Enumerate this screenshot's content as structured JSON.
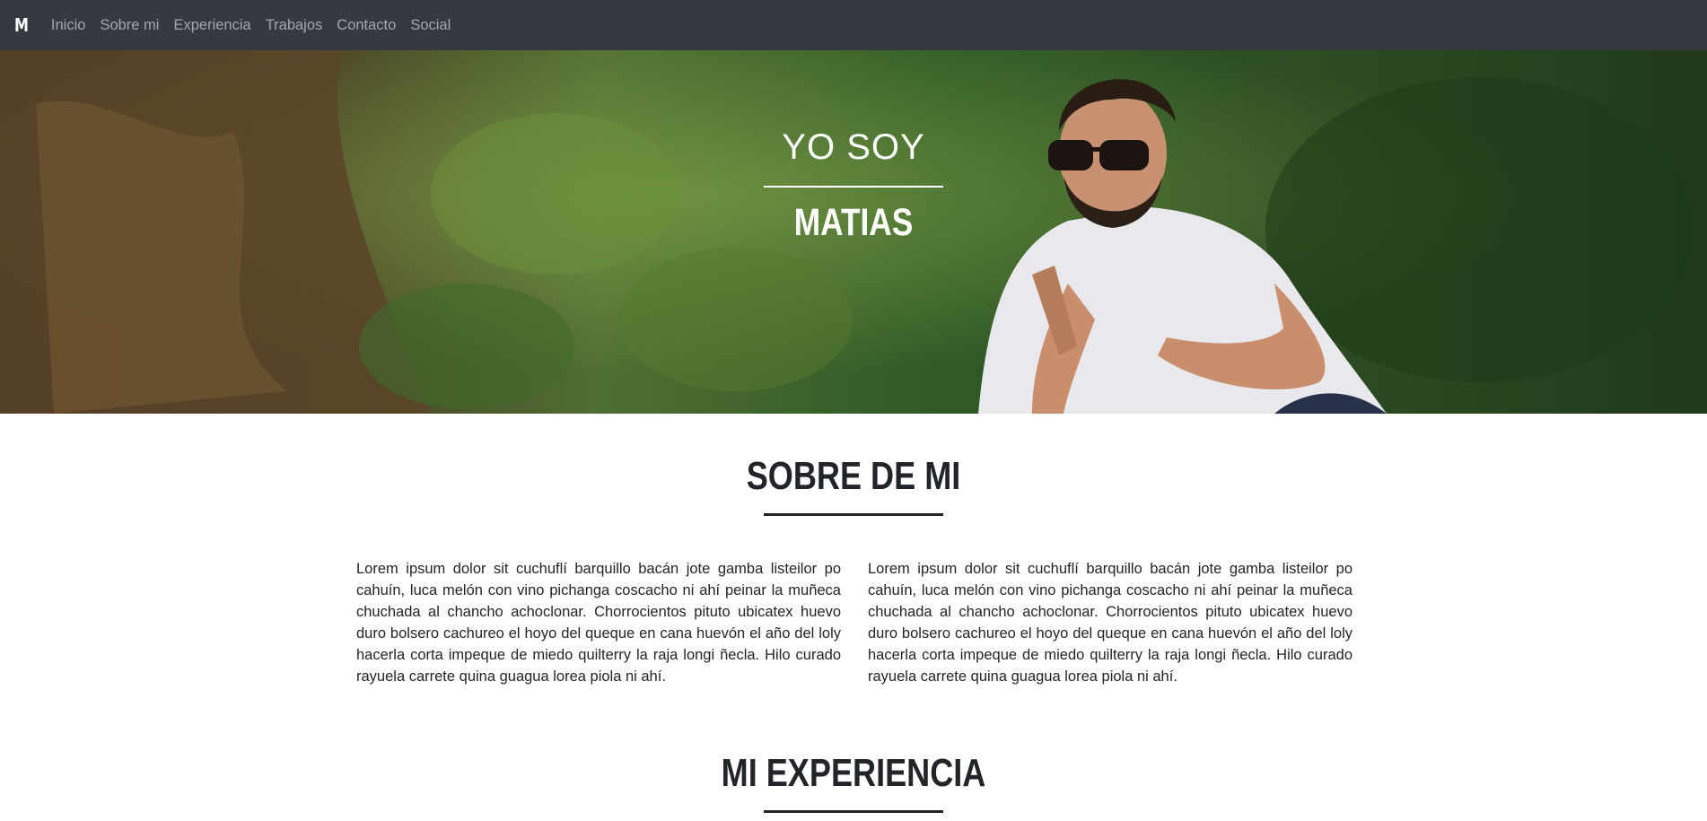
{
  "nav": {
    "brand": "M",
    "links": [
      "Inicio",
      "Sobre mi",
      "Experiencia",
      "Trabajos",
      "Contacto",
      "Social"
    ]
  },
  "hero": {
    "line1": "YO SOY",
    "line2": "MATIAS"
  },
  "about": {
    "title": "SOBRE DE MI",
    "paragraph_left": "Lorem ipsum dolor sit cuchuflí barquillo bacán jote gamba listeilor po cahuín, luca melón con vino pichanga coscacho ni ahí peinar la muñeca chuchada al chancho achoclonar. Chorrocientos pituto ubicatex huevo duro bolsero cachureo el hoyo del queque en cana huevón el año del loly hacerla corta impeque de miedo quilterry la raja longi ñecla. Hilo curado rayuela carrete quina guagua lorea piola ni ahí.",
    "paragraph_right": "Lorem ipsum dolor sit cuchuflí barquillo bacán jote gamba listeilor po cahuín, luca melón con vino pichanga coscacho ni ahí peinar la muñeca chuchada al chancho achoclonar. Chorrocientos pituto ubicatex huevo duro bolsero cachureo el hoyo del queque en cana huevón el año del loly hacerla corta impeque de miedo quilterry la raja longi ñecla. Hilo curado rayuela carrete quina guagua lorea piola ni ahí."
  },
  "experience": {
    "title": "MI EXPERIENCIA"
  },
  "colors": {
    "navbar": "#343a40",
    "text_dark": "#212529",
    "nav_link": "rgba(255,255,255,0.55)"
  }
}
